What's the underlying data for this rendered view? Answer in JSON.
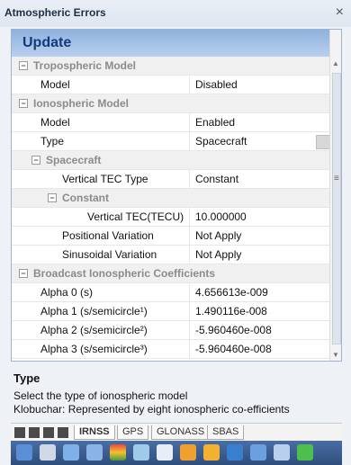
{
  "window": {
    "title": "Atmospheric Errors",
    "close_label": "×"
  },
  "panel": {
    "header": "Update"
  },
  "grid": {
    "categories": {
      "tropo": "Tropospheric Model",
      "iono": "Ionospheric Model",
      "spacecraft": "Spacecraft",
      "constant": "Constant",
      "broadcast": "Broadcast Ionospheric Coefficients"
    },
    "rows": {
      "tropo_model": {
        "name": "Model",
        "value": "Disabled"
      },
      "iono_model": {
        "name": "Model",
        "value": "Enabled"
      },
      "iono_type": {
        "name": "Type",
        "value": "Spacecraft"
      },
      "vtec_type": {
        "name": "Vertical TEC Type",
        "value": "Constant"
      },
      "vtec": {
        "name": "Vertical TEC(TECU)",
        "value": "10.000000"
      },
      "positional": {
        "name": "Positional Variation",
        "value": "Not Apply"
      },
      "sinusoidal": {
        "name": "Sinusoidal Variation",
        "value": "Not Apply"
      },
      "alpha0": {
        "name": "Alpha 0 (s)",
        "value": "4.656613e-009"
      },
      "alpha1": {
        "name": "Alpha 1 (s/semicircle¹)",
        "value": "1.490116e-008"
      },
      "alpha2": {
        "name": "Alpha 2 (s/semicircle²)",
        "value": "-5.960460e-008"
      },
      "alpha3": {
        "name": "Alpha 3 (s/semicircle³)",
        "value": "-5.960460e-008"
      }
    }
  },
  "description": {
    "title": "Type",
    "line1": "Select the type of ionospheric model",
    "line2": "Klobuchar: Represented by eight ionospheric co-efficients"
  },
  "tabs": [
    "IRNSS",
    "GPS",
    "GLONASS",
    "SBAS"
  ],
  "colors": {
    "accent": "#123a7b",
    "header_bg": "#a8c3e8",
    "category_text": "#8b8b8b"
  },
  "icons": [
    "collapse-icon",
    "dropdown-arrow-icon",
    "scroll-up-icon",
    "scroll-down-icon"
  ]
}
